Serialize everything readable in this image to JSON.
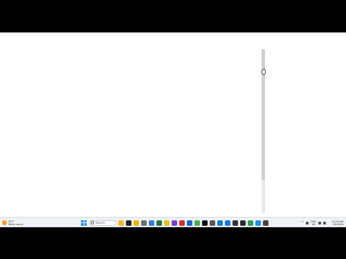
{
  "taskbar": {
    "weather": {
      "line1": "34°F",
      "line2": "Partly sunny"
    },
    "search_label": "Search",
    "pinned_icons": [
      {
        "name": "file-explorer-icon",
        "color": "#f2b92b"
      },
      {
        "name": "media-player-icon",
        "color": "#222222"
      },
      {
        "name": "folder-icon",
        "color": "#f0b400"
      },
      {
        "name": "settings-icon",
        "color": "#6b6b6b"
      },
      {
        "name": "camera-icon",
        "color": "#3a7bd5"
      },
      {
        "name": "excel-icon",
        "color": "#217346"
      },
      {
        "name": "notes-icon",
        "color": "#e8c21a"
      },
      {
        "name": "visual-studio-icon",
        "color": "#7b3fc4"
      },
      {
        "name": "security-icon",
        "color": "#d32f2f"
      },
      {
        "name": "ie-icon",
        "color": "#1e63c6"
      },
      {
        "name": "chrome-icon",
        "color": "#4caf50"
      },
      {
        "name": "github-icon",
        "color": "#111111"
      },
      {
        "name": "wrench-icon",
        "color": "#555555"
      },
      {
        "name": "edge-icon",
        "color": "#0f7bd6"
      },
      {
        "name": "vscode-icon",
        "color": "#1a73e8"
      },
      {
        "name": "obs-icon",
        "color": "#333333"
      },
      {
        "name": "terminal-icon",
        "color": "#2b2b2b"
      },
      {
        "name": "maps-icon",
        "color": "#2e9a5e"
      },
      {
        "name": "remote-desktop-icon",
        "color": "#1d8fe0"
      },
      {
        "name": "snipping-tool-icon",
        "color": "#444444"
      }
    ],
    "tray": {
      "lang_line1": "ENG",
      "lang_line2": "US",
      "time": "10:10 AM",
      "date": "1/5/2024"
    }
  }
}
